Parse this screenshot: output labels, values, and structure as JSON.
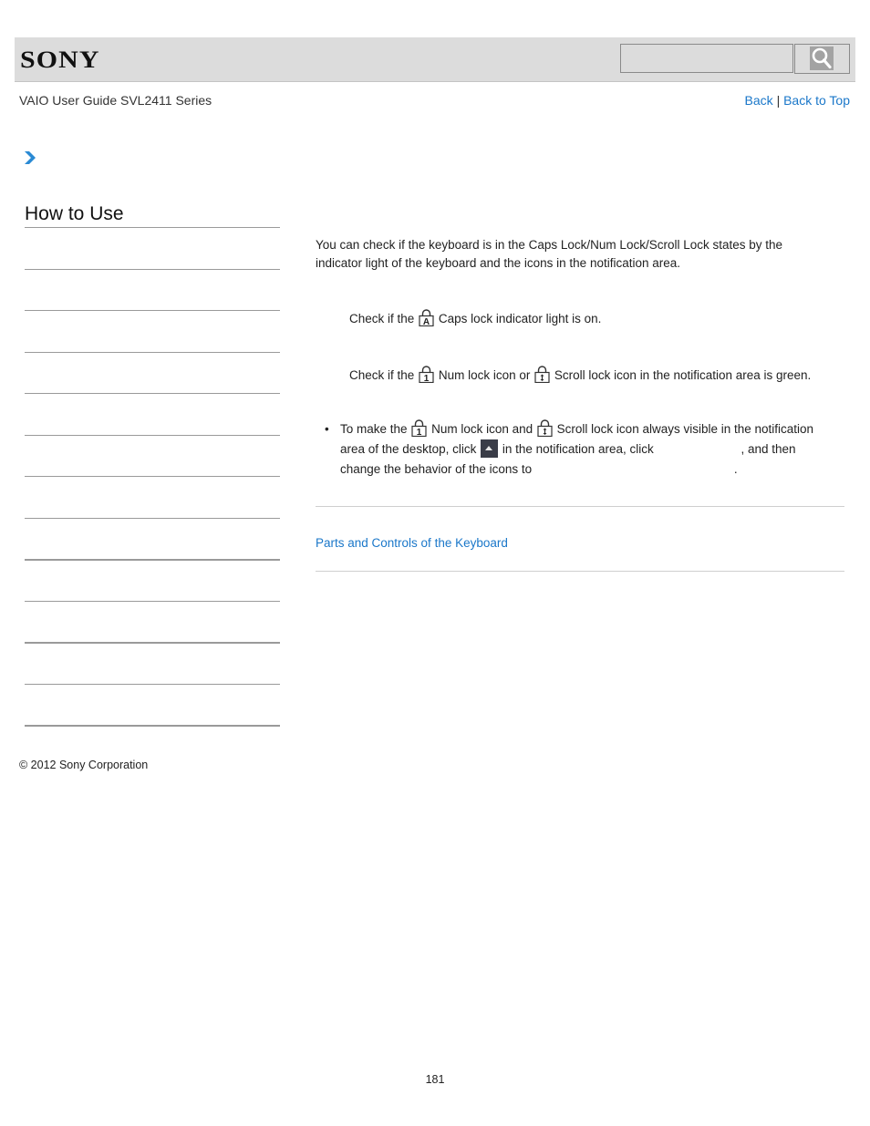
{
  "header": {
    "logo": "SONY",
    "search": {
      "value": "",
      "placeholder": ""
    },
    "search_button_icon": "magnifier-icon"
  },
  "subheader": {
    "guide_title": "VAIO User Guide SVL2411 Series",
    "back_label": "Back",
    "separator": "|",
    "back_to_top_label": "Back to Top"
  },
  "breadcrumb": {
    "icon": "chevron-right-icon"
  },
  "sidebar": {
    "title": "How to Use",
    "items": [
      {
        "label": ""
      },
      {
        "label": ""
      },
      {
        "label": ""
      },
      {
        "label": ""
      },
      {
        "label": ""
      },
      {
        "label": ""
      },
      {
        "label": ""
      },
      {
        "label": ""
      },
      {
        "label": ""
      },
      {
        "label": ""
      },
      {
        "label": ""
      },
      {
        "label": ""
      }
    ]
  },
  "main": {
    "intro": "You can check if the keyboard is in the Caps Lock/Num Lock/Scroll Lock states by the indicator light of the keyboard and the icons in the notification area.",
    "step1": {
      "prefix": "Check if the",
      "icon": "caps-lock-icon",
      "suffix": "Caps lock indicator light is on."
    },
    "step2": {
      "prefix": "Check if the",
      "icon1": "num-lock-icon",
      "middle": "Num lock icon or",
      "icon2": "scroll-lock-icon",
      "suffix": "Scroll lock icon in the notification area is green."
    },
    "note": {
      "bullet": "•",
      "part1": "To make the",
      "part2": "Num lock icon and",
      "part3": "Scroll lock icon always visible in the notification area of the desktop, click",
      "part4": "in the notification area, click",
      "part5": ", and then change the behavior of the icons to",
      "part6": "."
    },
    "related_link": "Parts and Controls of the Keyboard"
  },
  "footer": {
    "copyright": "© 2012 Sony Corporation",
    "page_number": "181"
  },
  "colors": {
    "link": "#1a77c9",
    "header_bg": "#dcdcdc",
    "chevron": "#2a8ad4",
    "tray_button": "#3a3d48"
  }
}
